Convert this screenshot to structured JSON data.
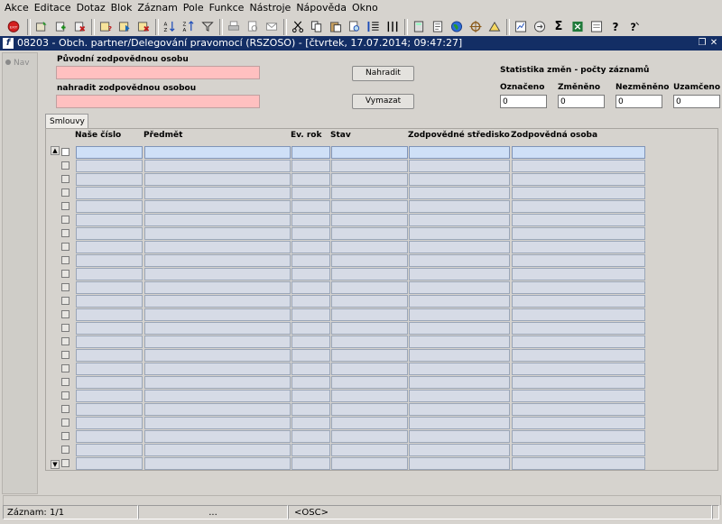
{
  "menu": [
    "Akce",
    "Editace",
    "Dotaz",
    "Blok",
    "Záznam",
    "Pole",
    "Funkce",
    "Nástroje",
    "Nápověda",
    "Okno"
  ],
  "toolbar_icons": [
    "exit-icon",
    "save-icon",
    "new-record-icon",
    "delete-record-icon",
    "enter-query-icon",
    "execute-query-icon",
    "cancel-query-icon",
    "sort-ascending-icon",
    "sort-descending-icon",
    "filter-icon",
    "print-icon",
    "print-preview-icon",
    "mail-icon",
    "cut-icon",
    "copy-icon",
    "paste-icon",
    "find-icon",
    "list-icon",
    "columns-icon",
    "calculator-icon",
    "document-icon",
    "globe-icon",
    "navigator-icon",
    "chart-icon",
    "report-icon",
    "sum-icon",
    "excel-icon",
    "export-icon",
    "help-icon",
    "context-help-icon"
  ],
  "window": {
    "title": "08203 - Obch. partner/Delegování pravomocí (RSZOSO) - [čtvrtek, 17.07.2014; 09:47:27]",
    "logo": "f"
  },
  "nav": {
    "label": "Nav"
  },
  "form": {
    "original_label": "Původní zodpovědnou osobu",
    "replace_label": "nahradit zodpovědnou osobou",
    "original_value": "",
    "replace_value": "",
    "replace_button": "Nahradit",
    "clear_button": "Vymazat"
  },
  "stats": {
    "title": "Statistika změn - počty záznamů",
    "items": [
      {
        "label": "Označeno",
        "value": "0"
      },
      {
        "label": "Změněno",
        "value": "0"
      },
      {
        "label": "Nezměněno",
        "value": "0"
      },
      {
        "label": "Uzamčeno",
        "value": "0"
      }
    ]
  },
  "tabs": [
    {
      "label": "Smlouvy"
    }
  ],
  "table": {
    "columns": [
      "Naše číslo",
      "Předmět",
      "Ev. rok",
      "Stav",
      "Zodpovědné středisko",
      "Zodpovědná osoba"
    ],
    "row_count": 24
  },
  "statusbar": {
    "record": "Záznam: 1/1",
    "ellipsis": "...",
    "osc": "<OSC>"
  },
  "colors": {
    "title_bar": "#132e65",
    "required_field": "#ffc0c0",
    "current_row": "#cfe0f7"
  }
}
